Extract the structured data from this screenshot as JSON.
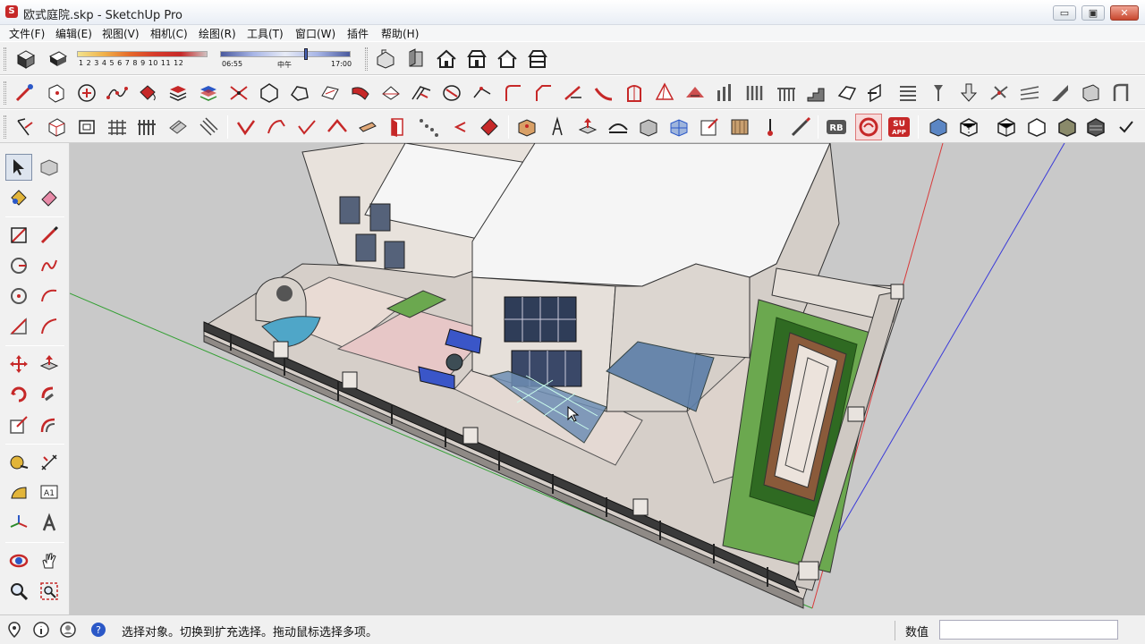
{
  "window": {
    "title": "欧式庭院.skp - SketchUp Pro",
    "minimize": "▭",
    "maximize": "▣",
    "close": "✕"
  },
  "menu": {
    "items": [
      {
        "label": "文件(F)"
      },
      {
        "label": "编辑(E)"
      },
      {
        "label": "视图(V)"
      },
      {
        "label": "相机(C)"
      },
      {
        "label": "绘图(R)"
      },
      {
        "label": "工具(T)"
      },
      {
        "label": "窗口(W)"
      },
      {
        "label": "插件"
      },
      {
        "label": "帮助(H)"
      }
    ]
  },
  "shadow": {
    "months": "1 2 3 4 5 6 7 8 9 10 11 12",
    "time_start": "06:55",
    "time_mid": "中午",
    "time_end": "17:00"
  },
  "toolbar_icons": {
    "su_app_line1": "SU",
    "su_app_line2": "APP",
    "rb": "RB"
  },
  "left_tools": {
    "text_tool": "A1"
  },
  "status": {
    "message": "选择对象。切换到扩充选择。拖动鼠标选择多项。",
    "vcb_label": "数值",
    "vcb_value": ""
  },
  "colors": {
    "viewport_bg": "#c9c9c9",
    "lawn": "#6ba84f",
    "glass": "#6f8fb5",
    "roof": "#f4f4f4",
    "axis_red": "#d83a3a",
    "axis_green": "#35a035",
    "axis_blue": "#3a3ad8"
  }
}
